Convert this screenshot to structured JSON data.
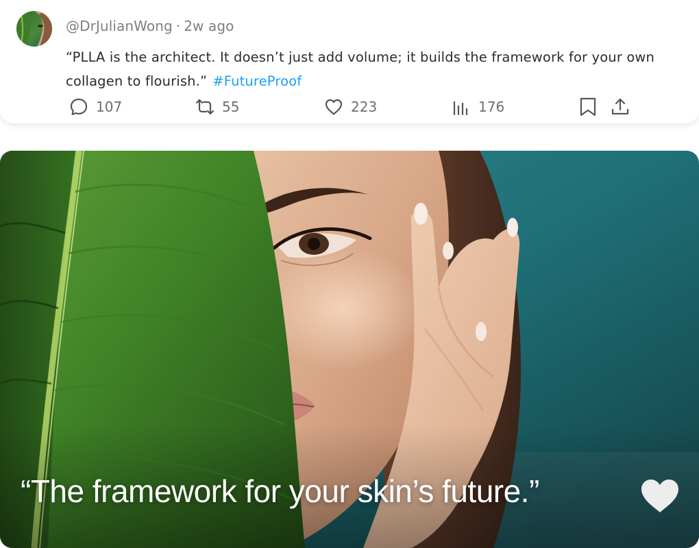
{
  "post": {
    "handle": "@DrJulianWong",
    "separator": "·",
    "time": "2w ago",
    "text": "“PLLA is the architect. It doesn’t just add volume; it builds the framework for your own collagen to flourish.”",
    "hashtag": "#FutureProof",
    "actions": {
      "reply_count": "107",
      "retweet_count": "55",
      "like_count": "223",
      "views_count": "176"
    },
    "icons": {
      "reply": "speech-bubble-icon",
      "retweet": "retweet-icon",
      "like": "heart-outline-icon",
      "views": "bar-chart-icon",
      "bookmark": "bookmark-icon",
      "share": "share-upload-icon"
    }
  },
  "image": {
    "caption": "“The framework for your skin’s future.”",
    "caption_icon": "heart-filled-icon"
  },
  "colors": {
    "hashtag": "#1da1f2",
    "meta_text": "#7f7f7f",
    "body_text": "#2b2b2b",
    "caption_text": "#ffffff"
  }
}
